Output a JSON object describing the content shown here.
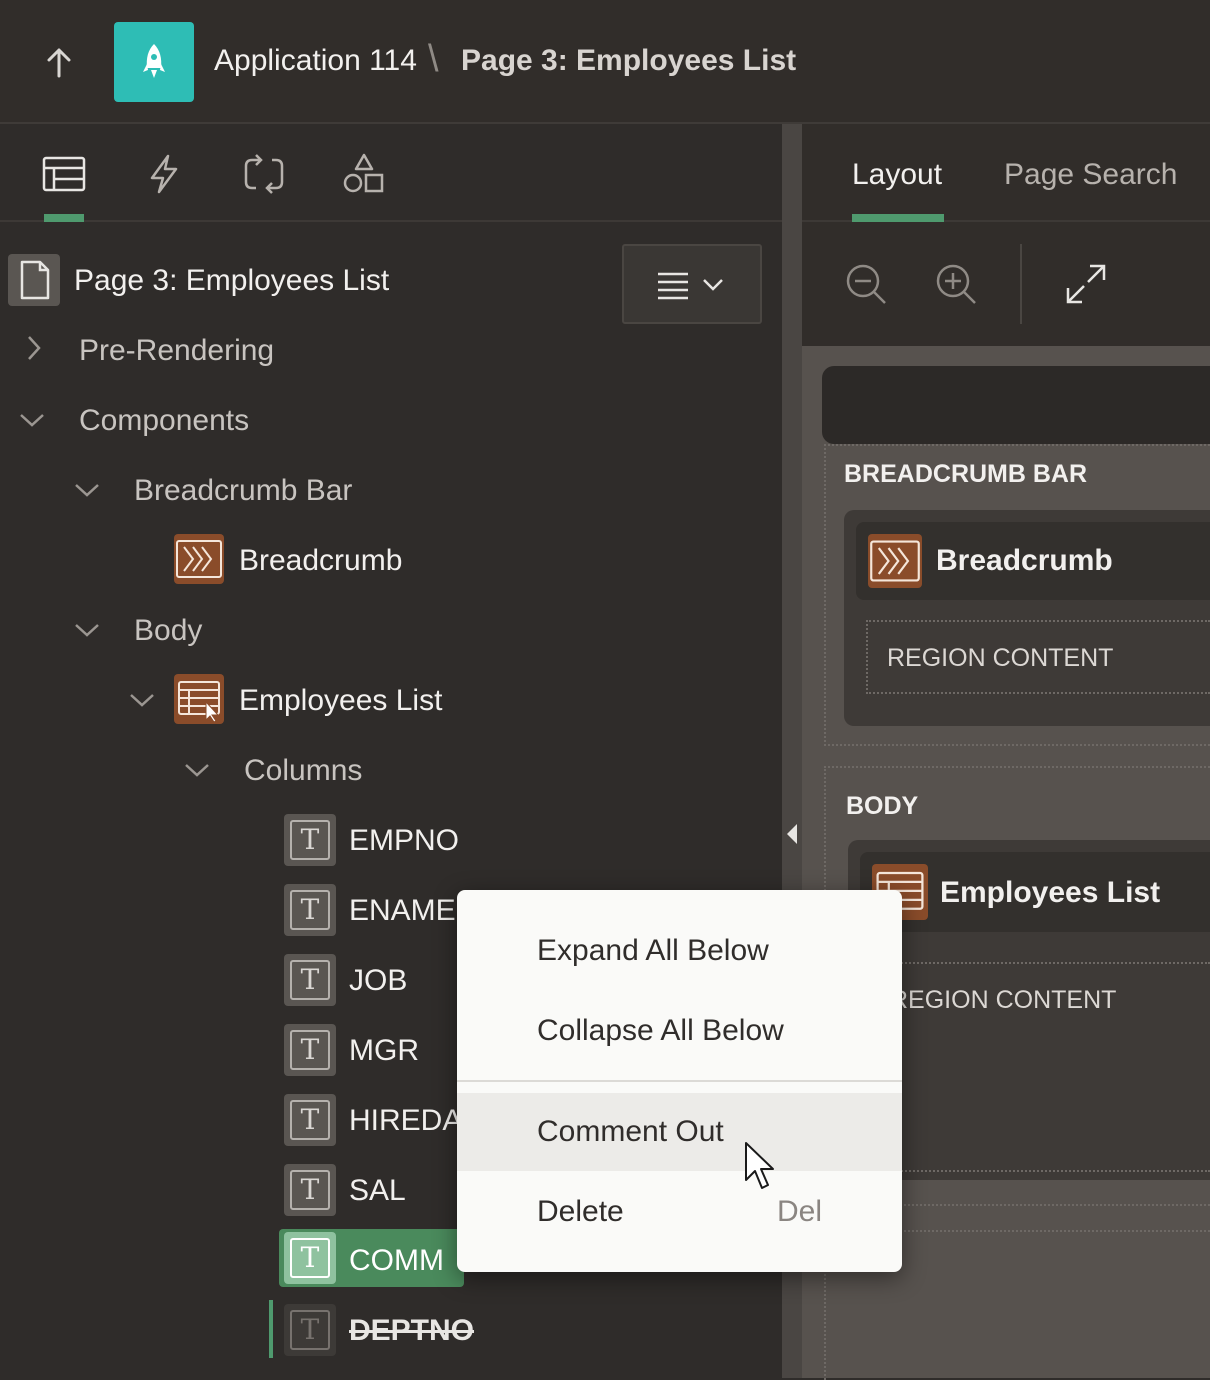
{
  "header": {
    "app_title": "Application 114",
    "separator": "\\",
    "page_title": "Page 3: Employees List",
    "logo_color": "#2ebdb5"
  },
  "left_tabs": [
    {
      "name": "rendering",
      "icon": "rendering-tree-icon",
      "active": true
    },
    {
      "name": "dynamic-actions",
      "icon": "lightning-icon",
      "active": false
    },
    {
      "name": "processing",
      "icon": "processing-cycle-icon",
      "active": false
    },
    {
      "name": "shared-components",
      "icon": "shapes-icon",
      "active": false
    }
  ],
  "tree": {
    "root_label": "Page 3: Employees List",
    "pre_rendering": "Pre-Rendering",
    "components": "Components",
    "breadcrumb_bar": "Breadcrumb Bar",
    "breadcrumb": "Breadcrumb",
    "body": "Body",
    "employees_list": "Employees List",
    "columns_label": "Columns",
    "columns": [
      "EMPNO",
      "ENAME",
      "JOB",
      "MGR",
      "HIREDATE",
      "SAL",
      "COMM",
      "DEPTNO"
    ],
    "selected_column": "COMM",
    "commented_column": "DEPTNO",
    "column_icon_glyph": "T"
  },
  "right_tabs": {
    "layout": "Layout",
    "page_search": "Page Search"
  },
  "layout_canvas": {
    "breadcrumb_bar_label": "BREADCRUMB BAR",
    "breadcrumb_region": "Breadcrumb",
    "region_content_1": "REGION CONTENT",
    "body_label": "BODY",
    "employees_region": "Employees List",
    "region_content_2": "REGION CONTENT"
  },
  "context_menu": {
    "items": [
      {
        "label": "Expand All Below",
        "shortcut": ""
      },
      {
        "label": "Collapse All Below",
        "shortcut": ""
      },
      {
        "label": "Comment Out",
        "shortcut": ""
      },
      {
        "label": "Delete",
        "shortcut": "Del"
      }
    ],
    "hovered": "Comment Out"
  },
  "colors": {
    "accent_green": "#4f9a6e",
    "selection_green": "#4a8a5c",
    "region_brown": "#8a4c2a"
  }
}
